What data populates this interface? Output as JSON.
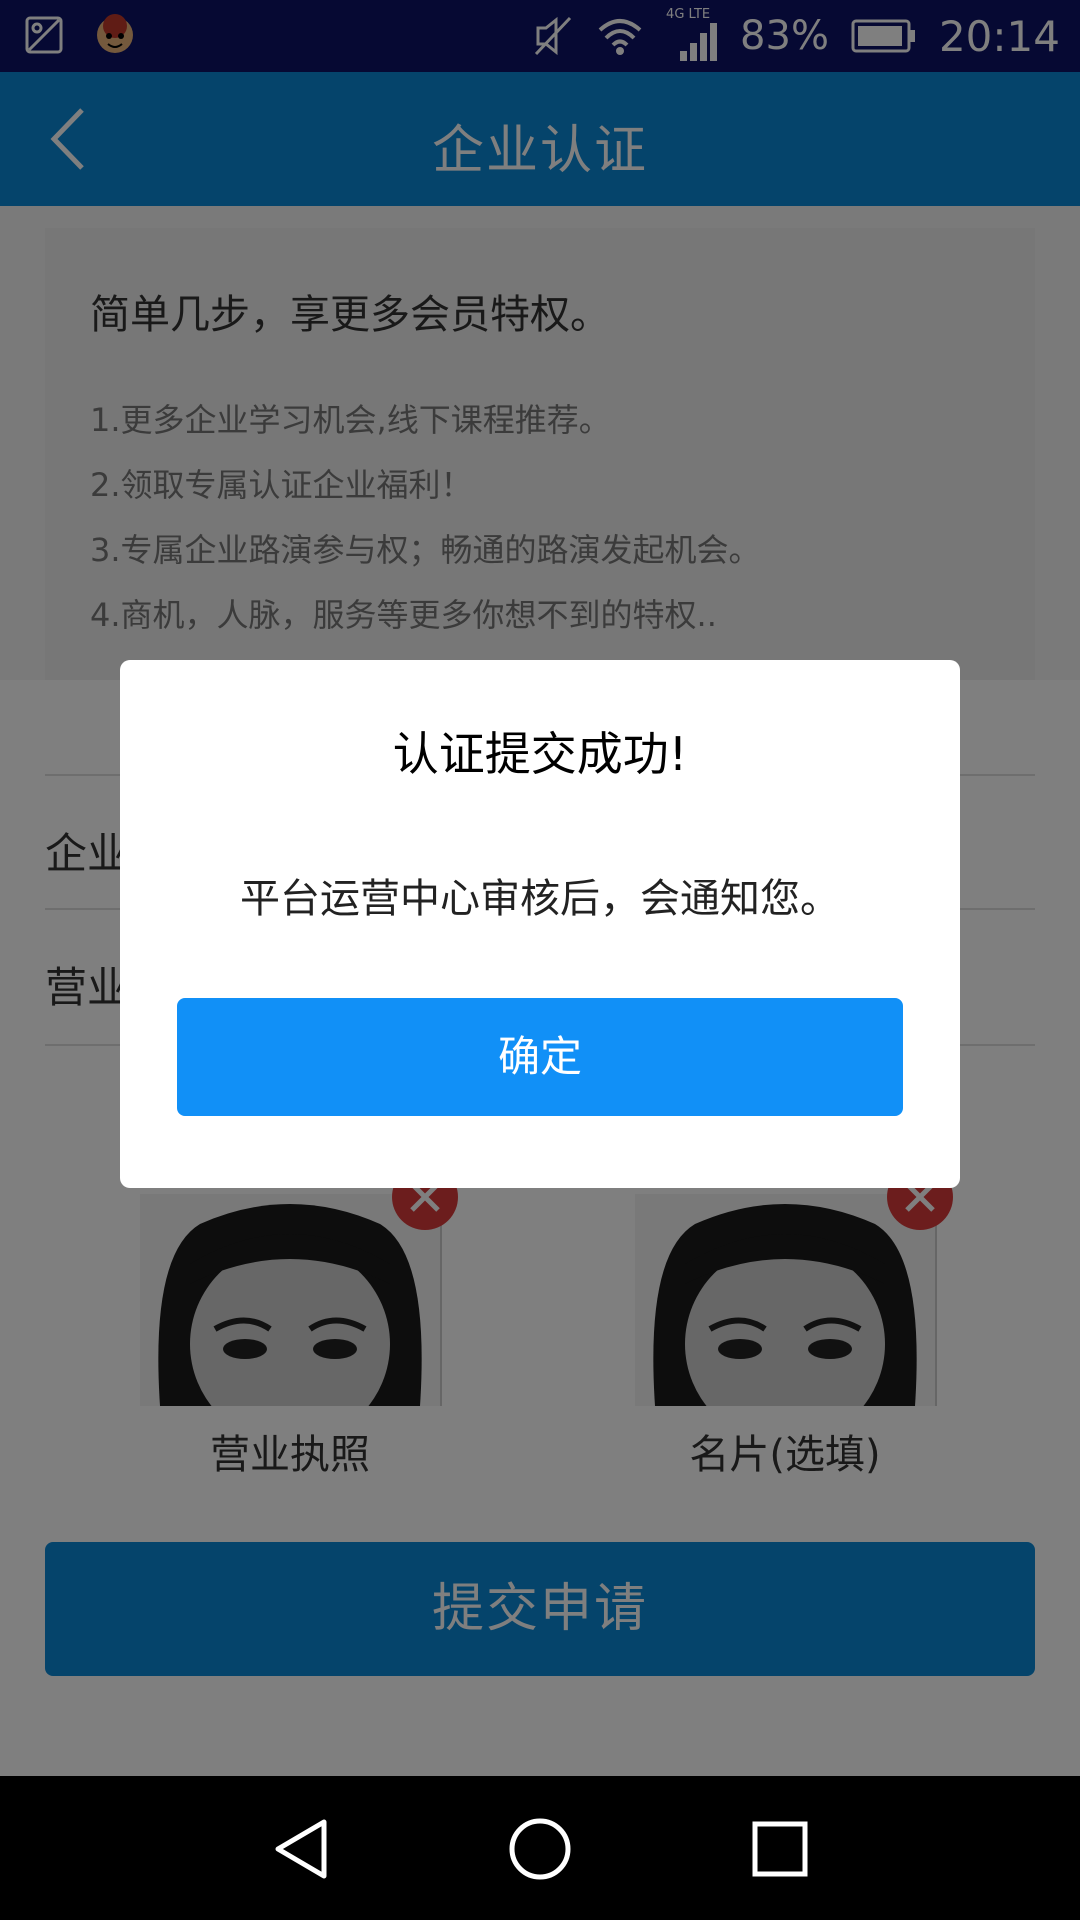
{
  "status_bar": {
    "network": "4G LTE",
    "battery": "83%",
    "time": "20:14"
  },
  "app_bar": {
    "title": "企业认证"
  },
  "intro": {
    "title": "简单几步，享更多会员特权。",
    "items": [
      "1.更多企业学习机会,线下课程推荐。",
      "2.领取专属认证企业福利！",
      "3.专属企业路演参与权；畅通的路演发起机会。",
      "4.商机，人脉，服务等更多你想不到的特权.."
    ]
  },
  "form": {
    "row1_label": "企业",
    "row2_label": "营业"
  },
  "photos": [
    {
      "caption": "营业执照"
    },
    {
      "caption": "名片(选填)"
    }
  ],
  "submit_button": "提交申请",
  "dialog": {
    "title": "认证提交成功!",
    "message": "平台运营中心审核后，会通知您。",
    "confirm": "确定"
  },
  "colors": {
    "status_bar": "#0d1266",
    "app_bar": "#0a88d6",
    "dialog_button": "#1190f7",
    "delete_button": "#d93b3b"
  }
}
